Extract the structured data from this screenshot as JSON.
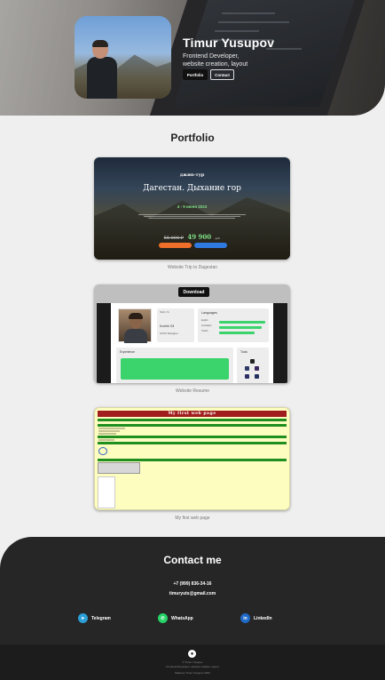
{
  "hero": {
    "name": "Timur Yusupov",
    "role_line1": "Frontend Developer,",
    "role_line2": "website creation, layout",
    "portfolio_btn": "Portfolio",
    "contact_btn": "Contact"
  },
  "portfolio": {
    "title": "Portfolio",
    "projects": [
      {
        "caption": "Website Trip to Dagestan",
        "pretitle": "джип-тур",
        "headline": "Дагестан. Дыхание гор",
        "dates": "4 - 9 июня 2023",
        "old_price": "55 000 ₽",
        "new_price": "49 900",
        "price_unit": "руб."
      },
      {
        "caption": "Website Resume",
        "download_label": "Download",
        "person_name": "Kozhik Gil",
        "person_role": "UX/UI Designer",
        "languages_label": "Languages",
        "lang_items": [
          "English",
          "Azerbaijani",
          "Turkish"
        ],
        "experience_label": "Experience",
        "tools_label": "Tools"
      },
      {
        "caption": "My first web page",
        "header_text": "My first web page"
      }
    ]
  },
  "contact": {
    "title": "Contact me",
    "phone": "+7 (999) 836-34-16",
    "email": "timuryuts@gmail.com",
    "links": [
      {
        "label": "Telegram",
        "icon": "telegram-icon"
      },
      {
        "label": "WhatsApp",
        "icon": "whatsapp-icon"
      },
      {
        "label": "LinkedIn",
        "icon": "linkedin-icon"
      }
    ]
  },
  "footer": {
    "line1": "© Timur Yusupov",
    "line2": "Frontend Developer, website creation, layout",
    "line3": "Made by Timur Yusupov 2023"
  },
  "colors": {
    "accent_green": "#3bd36b",
    "dark_bg": "#262626",
    "page_bg": "#efefef"
  }
}
